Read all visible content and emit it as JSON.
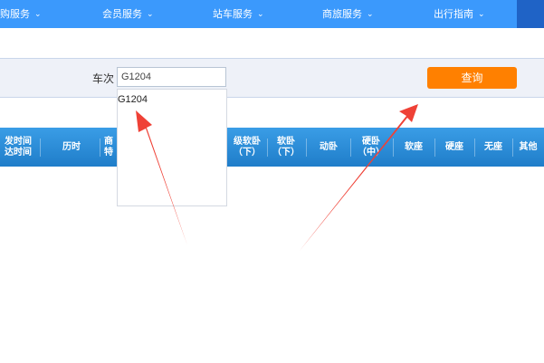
{
  "nav": {
    "items": [
      {
        "label": "购服务"
      },
      {
        "label": "会员服务"
      },
      {
        "label": "站车服务"
      },
      {
        "label": "商旅服务"
      },
      {
        "label": "出行指南"
      }
    ]
  },
  "query": {
    "train_label": "车次",
    "train_value": "G1204",
    "button_label": "查询"
  },
  "dropdown": {
    "items": [
      "G1204"
    ]
  },
  "table": {
    "headers": [
      {
        "label": "发时间\n达时间"
      },
      {
        "label": "历时"
      },
      {
        "label": "商\n特"
      },
      {
        "label": "级软卧\n（下）"
      },
      {
        "label": "软卧\n（下）"
      },
      {
        "label": "动卧"
      },
      {
        "label": "硬卧\n（中）"
      },
      {
        "label": "软座"
      },
      {
        "label": "硬座"
      },
      {
        "label": "无座"
      },
      {
        "label": "其他"
      }
    ]
  },
  "colors": {
    "nav": "#3b99fc",
    "accent": "#ff8000",
    "table_header": "#2a8ad6",
    "annotation": "#ef4136"
  }
}
